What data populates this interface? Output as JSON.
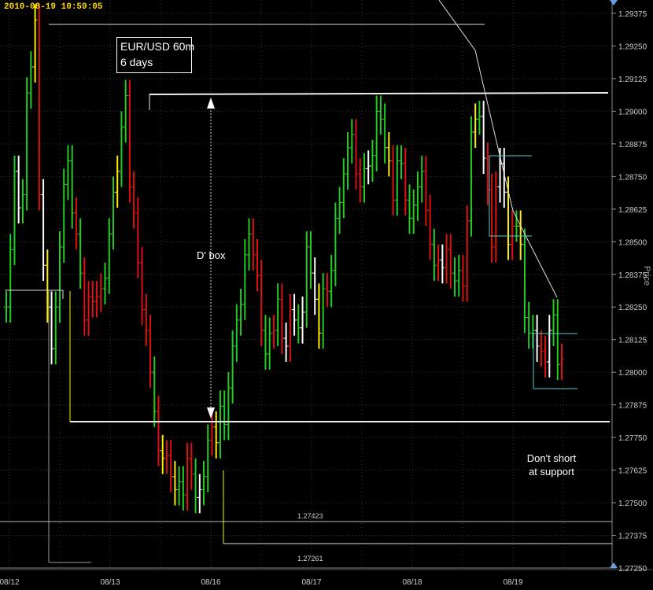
{
  "timestamp": "2010-08-19  10:59:05",
  "chart_data": {
    "type": "ohlc",
    "title": "EUR/USD 60m",
    "subtitle": "6 days",
    "ylabel": "Price",
    "ylim": [
      1.2725,
      1.29375
    ],
    "y_ticks": [
      "1.29375",
      "1.29250",
      "1.29125",
      "1.29000",
      "1.28875",
      "1.28750",
      "1.28625",
      "1.28500",
      "1.28375",
      "1.28250",
      "1.28125",
      "1.28000",
      "1.27875",
      "1.27750",
      "1.27625",
      "1.27500",
      "1.27375",
      "1.27250"
    ],
    "x_ticks": [
      "08/12",
      "08/13",
      "08/16",
      "08/17",
      "08/18",
      "08/19"
    ],
    "bar_colors": {
      "up": "#22cc22",
      "down": "#dd1111",
      "doji": "#ffffff",
      "swing": "#ffee00"
    },
    "series": [
      {
        "price": [
          1.2825,
          1.2847,
          1.2877,
          1.2863,
          1.2868,
          1.2907,
          1.2917,
          1.2935,
          1.2868,
          1.2841,
          1.2825,
          1.2809,
          1.2825,
          1.2848,
          1.2872,
          1.2881,
          1.2861,
          1.2853,
          1.2838,
          1.282,
          1.2829,
          1.2827,
          1.2829,
          1.2832,
          1.2836,
          1.2853,
          1.2869,
          1.2877,
          1.2894,
          1.2906,
          1.2871,
          1.2861,
          1.2842,
          1.2824,
          1.2816,
          1.28,
          1.2785,
          1.277,
          1.2767,
          1.2768,
          1.276,
          1.2755,
          1.2758,
          1.2753,
          1.2767,
          1.2761,
          1.2752,
          1.2755,
          1.276,
          1.2774,
          1.2779,
          1.2773,
          1.2787,
          1.278,
          1.2794,
          1.281,
          1.282,
          1.2826,
          1.2845,
          1.2853,
          1.2845,
          1.2837,
          1.2816,
          1.2807,
          1.2815,
          1.2816,
          1.2828,
          1.2813,
          1.281,
          1.2824,
          1.282,
          1.2817,
          1.2823,
          1.2848,
          1.2838,
          1.2828,
          1.2815,
          1.2832,
          1.2831,
          1.2839,
          1.2859,
          1.2865,
          1.2876,
          1.2886,
          1.2891,
          1.2876,
          1.2871,
          1.2878,
          1.2879,
          1.2883,
          1.29,
          1.2897,
          1.2886,
          1.2881,
          1.2866,
          1.2881,
          1.288,
          1.2866,
          1.2859,
          1.2864,
          1.2871,
          1.2877,
          1.2862,
          1.2849,
          1.2841,
          1.2843,
          1.284,
          1.2847,
          1.2838,
          1.2835,
          1.2839,
          1.2833,
          1.2858,
          1.2892,
          1.2897,
          1.2898,
          1.2882,
          1.287,
          1.2848,
          1.2871,
          1.288,
          1.2869,
          1.2849,
          1.2856,
          1.2856,
          1.2849,
          1.2821,
          1.2815,
          1.2816,
          1.281,
          1.2808,
          1.2804,
          1.2816,
          1.2822,
          1.2803,
          1.2805
        ],
        "dir": [
          "up",
          "up",
          "up",
          "doji",
          "up",
          "up",
          "up",
          "swing",
          "down",
          "doji",
          "swing",
          "doji",
          "up",
          "up",
          "up",
          "up",
          "up",
          "down",
          "up",
          "down",
          "down",
          "down",
          "down",
          "down",
          "up",
          "up",
          "up",
          "swing",
          "up",
          "up",
          "down",
          "down",
          "down",
          "down",
          "down",
          "down",
          "up",
          "down",
          "swing",
          "down",
          "down",
          "swing",
          "up",
          "up",
          "down",
          "down",
          "up",
          "doji",
          "up",
          "up",
          "down",
          "swing",
          "up",
          "up",
          "up",
          "up",
          "up",
          "up",
          "up",
          "up",
          "down",
          "down",
          "down",
          "up",
          "up",
          "down",
          "up",
          "down",
          "doji",
          "down",
          "doji",
          "up",
          "doji",
          "up",
          "up",
          "doji",
          "swing",
          "up",
          "down",
          "up",
          "up",
          "up",
          "up",
          "up",
          "up",
          "down",
          "down",
          "up",
          "doji",
          "up",
          "up",
          "up",
          "up",
          "swing",
          "down",
          "up",
          "up",
          "down",
          "up",
          "up",
          "up",
          "up",
          "down",
          "down",
          "up",
          "down",
          "doji",
          "down",
          "down",
          "up",
          "up",
          "down",
          "down",
          "up",
          "swing",
          "up",
          "doji",
          "down",
          "down",
          "down",
          "doji",
          "doji",
          "swing",
          "down",
          "up",
          "swing",
          "up",
          "up",
          "up",
          "doji",
          "down",
          "down",
          "doji",
          "up",
          "up",
          "down",
          "up",
          "swing"
        ]
      }
    ],
    "reference_lines": [
      {
        "label": "1.27423",
        "value": 1.27423
      },
      {
        "label": "1.27261",
        "value": 1.27261
      }
    ],
    "annotations": {
      "box_label": "D' box",
      "note_line1": "Don't short",
      "note_line2": "at support"
    }
  }
}
